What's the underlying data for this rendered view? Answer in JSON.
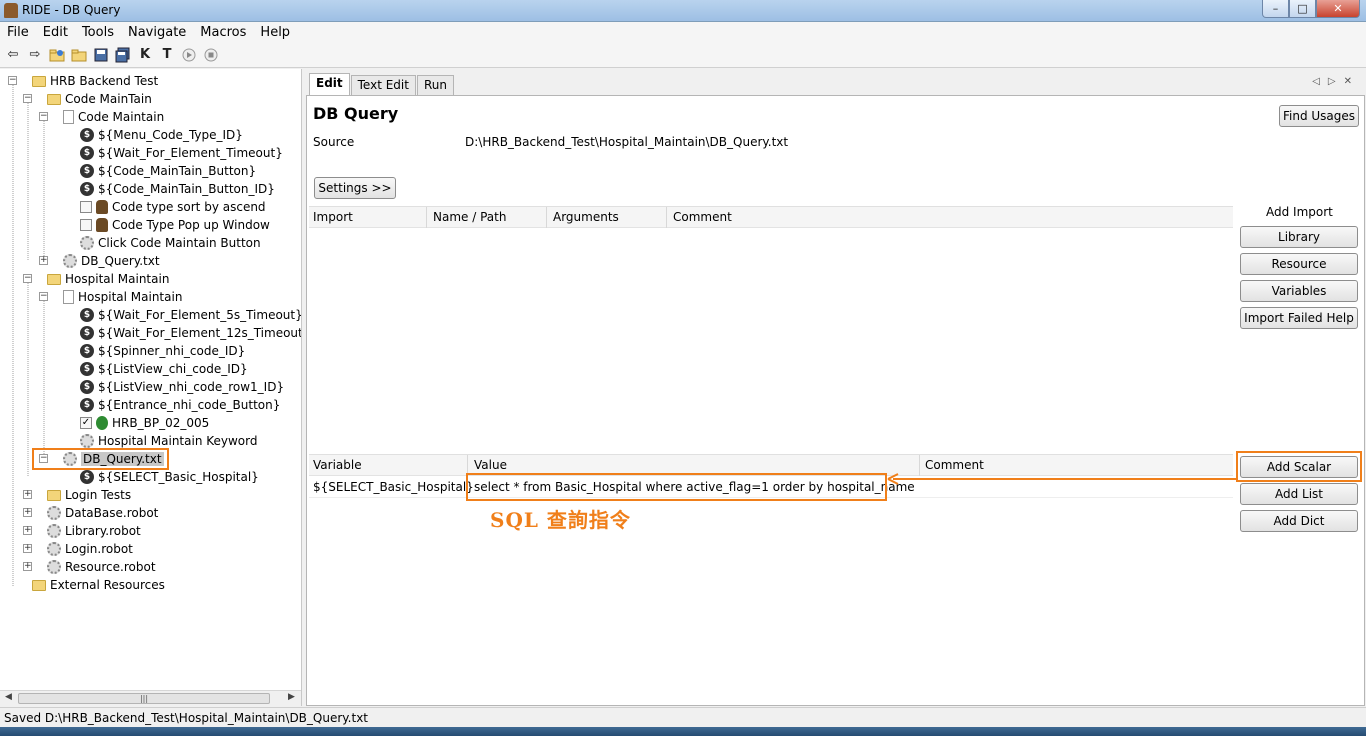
{
  "window": {
    "title": "RIDE - DB Query"
  },
  "menu": [
    "File",
    "Edit",
    "Tools",
    "Navigate",
    "Macros",
    "Help"
  ],
  "toolbar": {
    "icons": [
      "back-icon",
      "forward-icon",
      "open-icon",
      "open-folder-icon",
      "save-icon",
      "save-all-icon",
      "keyword-search-icon",
      "test-search-icon",
      "run-icon",
      "stop-icon"
    ],
    "k_glyph": "K",
    "t_glyph": "T"
  },
  "tree": {
    "root": "HRB Backend Test",
    "code_maintain_folder": "Code MainTain",
    "code_maintain_suite": "Code Maintain",
    "code_vars": [
      "${Menu_Code_Type_ID}",
      "${Wait_For_Element_Timeout}",
      "${Code_MainTain_Button}",
      "${Code_MainTain_Button_ID}"
    ],
    "code_tests": [
      "Code type sort by ascend",
      "Code Type Pop up Window"
    ],
    "code_keyword": "Click Code Maintain Button",
    "code_db_query": "DB_Query.txt",
    "hospital_folder": "Hospital Maintain",
    "hospital_suite": "Hospital Maintain",
    "hospital_vars": [
      "${Wait_For_Element_5s_Timeout}",
      "${Wait_For_Element_12s_Timeout}",
      "${Spinner_nhi_code_ID}",
      "${ListView_chi_code_ID}",
      "${ListView_nhi_code_row1_ID}",
      "${Entrance_nhi_code_Button}"
    ],
    "hospital_test": "HRB_BP_02_005",
    "hospital_keyword": "Hospital Maintain Keyword",
    "selected_resource": "DB_Query.txt",
    "selected_var": "${SELECT_Basic_Hospital}",
    "login_tests": "Login Tests",
    "robots": [
      "DataBase.robot",
      "Library.robot",
      "Login.robot",
      "Resource.robot"
    ],
    "external": "External Resources"
  },
  "editor": {
    "tabs": [
      "Edit",
      "Text Edit",
      "Run"
    ],
    "heading": "DB Query",
    "find_usages": "Find Usages",
    "source_label": "Source",
    "source_path": "D:\\HRB_Backend_Test\\Hospital_Maintain\\DB_Query.txt",
    "settings_btn": "Settings >>",
    "import_headers": [
      "Import",
      "Name / Path",
      "Arguments",
      "Comment"
    ],
    "add_import_label": "Add Import",
    "import_buttons": [
      "Library",
      "Resource",
      "Variables",
      "Import Failed Help"
    ],
    "var_headers": [
      "Variable",
      "Value",
      "Comment"
    ],
    "var_row": {
      "variable": "${SELECT_Basic_Hospital}",
      "value": "select * from Basic_Hospital where active_flag=1 order by hospital_name"
    },
    "var_buttons": [
      "Add Scalar",
      "Add List",
      "Add Dict"
    ],
    "annotation": "SQL 查詢指令",
    "annotation_color": "#f07f1a"
  },
  "status": "Saved D:\\HRB_Backend_Test\\Hospital_Maintain\\DB_Query.txt"
}
